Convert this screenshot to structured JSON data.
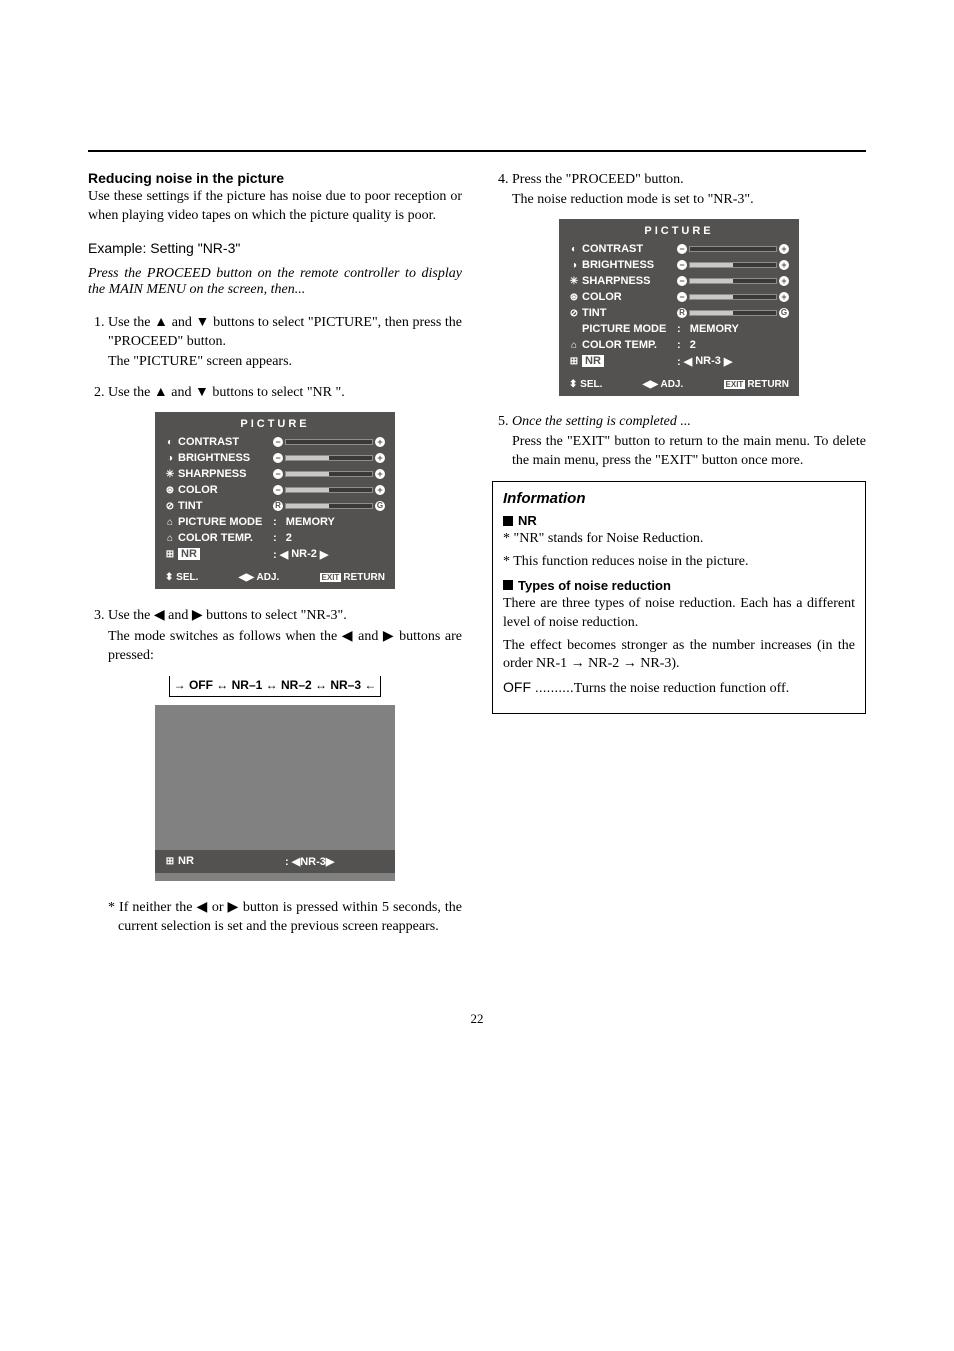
{
  "page_number": "22",
  "left": {
    "heading": "Reducing noise in the picture",
    "intro": "Use these settings if the picture has noise due to poor reception or when playing video tapes on which the picture quality is poor.",
    "example": "Example: Setting \"NR-3\"",
    "press_italic": "Press the PROCEED button on the remote controller to display the MAIN MENU on the screen, then...",
    "step1_a": "Use the ",
    "step1_b": " and ",
    "step1_c": " buttons to select \"PICTURE\", then press the \"PROCEED\" button.",
    "step1_d": "The \"PICTURE\" screen appears.",
    "step2_a": "Use the ",
    "step2_b": " and ",
    "step2_c": " buttons to select \"NR \".",
    "step3_a": "Use the ",
    "step3_b": " and ",
    "step3_c": " buttons to select \"NR-3\".",
    "step3_d1": "The mode switches as follows when the ",
    "step3_d2": " and ",
    "step3_d3": " buttons are pressed:",
    "chain": "→ OFF ↔ NR–1 ↔ NR–2 ↔ NR–3 ←",
    "footnote_a": "* If neither the ",
    "footnote_b": " or ",
    "footnote_c": " button is pressed within 5 seconds, the current selection is set and the previous screen reappears."
  },
  "right": {
    "step4_a": "Press the \"PROCEED\" button.",
    "step4_b": "The noise reduction mode is set to \"NR-3\".",
    "step5_a": "Once the setting is completed ...",
    "step5_b": "Press the \"EXIT\" button to return to the main menu. To delete the main menu, press the \"EXIT\" button once more."
  },
  "osd": {
    "title": "PICTURE",
    "rows": {
      "contrast": "CONTRAST",
      "brightness": "BRIGHTNESS",
      "sharpness": "SHARPNESS",
      "color": "COLOR",
      "tint": "TINT",
      "picture_mode": "PICTURE MODE",
      "picture_mode_val": "MEMORY",
      "color_temp": "COLOR TEMP.",
      "color_temp_val": "2",
      "nr": "NR",
      "nr_val_left": "NR-2",
      "nr_val_simple": "NR-3",
      "nr_val_right": "NR-3"
    },
    "foot": {
      "sel": "SEL.",
      "adj": "ADJ.",
      "ret": "RETURN",
      "exit": "EXIT"
    }
  },
  "info": {
    "title": "Information",
    "nr_head": "NR",
    "nr_p1": "* \"NR\" stands for Noise Reduction.",
    "nr_p2": "* This function reduces noise in the picture.",
    "types_head": "Types of noise reduction",
    "types_p1": "There are three types of noise reduction. Each has a different level of noise reduction.",
    "types_p2": "The effect becomes stronger as the number increases (in the order NR-1 → NR-2 → NR-3).",
    "types_off_label": "OFF ..........",
    "types_off_text": "Turns the noise reduction function off."
  }
}
